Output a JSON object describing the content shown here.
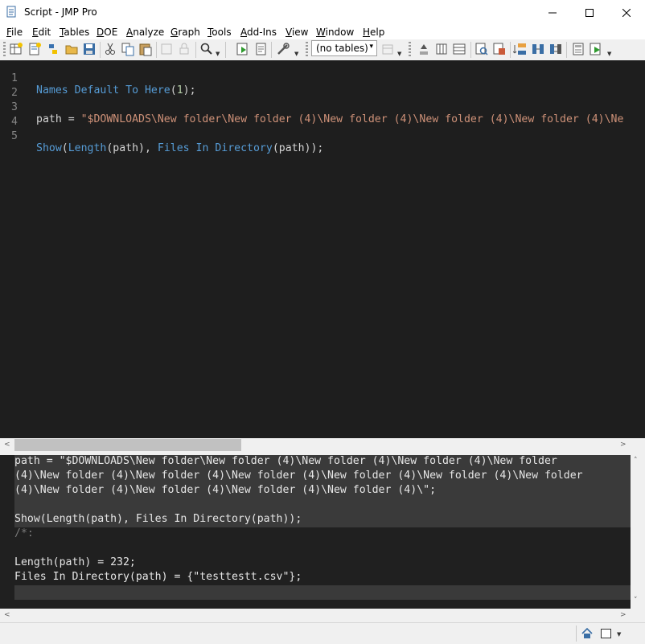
{
  "window": {
    "title": "Script - JMP Pro"
  },
  "menu": [
    {
      "u": "F",
      "rest": "ile"
    },
    {
      "u": "E",
      "rest": "dit"
    },
    {
      "u": "T",
      "rest": "ables"
    },
    {
      "u": "D",
      "rest": "OE"
    },
    {
      "u": "A",
      "rest": "nalyze"
    },
    {
      "u": "G",
      "rest": "raph"
    },
    {
      "u": "T",
      "rest": "ools"
    },
    {
      "u": "A",
      "rest": "dd-Ins"
    },
    {
      "u": "V",
      "rest": "iew"
    },
    {
      "u": "W",
      "rest": "indow"
    },
    {
      "u": "H",
      "rest": "elp"
    }
  ],
  "toolbar": {
    "table_select_value": "(no tables)"
  },
  "editor": {
    "line_numbers": [
      "1",
      "2",
      "3",
      "4",
      "5"
    ],
    "line1": {
      "fn": "Names Default To Here",
      "open": "(",
      "arg": "1",
      "close": ");"
    },
    "line3": {
      "var": "path = ",
      "string": "\"$DOWNLOADS\\New folder\\New folder (4)\\New folder (4)\\New folder (4)\\New folder (4)\\Ne"
    },
    "line5": {
      "fn1": "Show",
      "p1": "(",
      "fn2": "Length",
      "p2": "(path), ",
      "fn3": "Files In Directory",
      "p3": "(path));"
    }
  },
  "log": {
    "lines": [
      "path = \"$DOWNLOADS\\New folder\\New folder (4)\\New folder (4)\\New folder (4)\\New folder",
      "(4)\\New folder (4)\\New folder (4)\\New folder (4)\\New folder (4)\\New folder (4)\\New folder",
      "(4)\\New folder (4)\\New folder (4)\\New folder (4)\\New folder (4)\\\";",
      "",
      "Show(Length(path), Files In Directory(path));",
      "/*:",
      "",
      "Length(path) = 232;",
      "Files In Directory(path) = {\"testtestt.csv\"};"
    ]
  }
}
